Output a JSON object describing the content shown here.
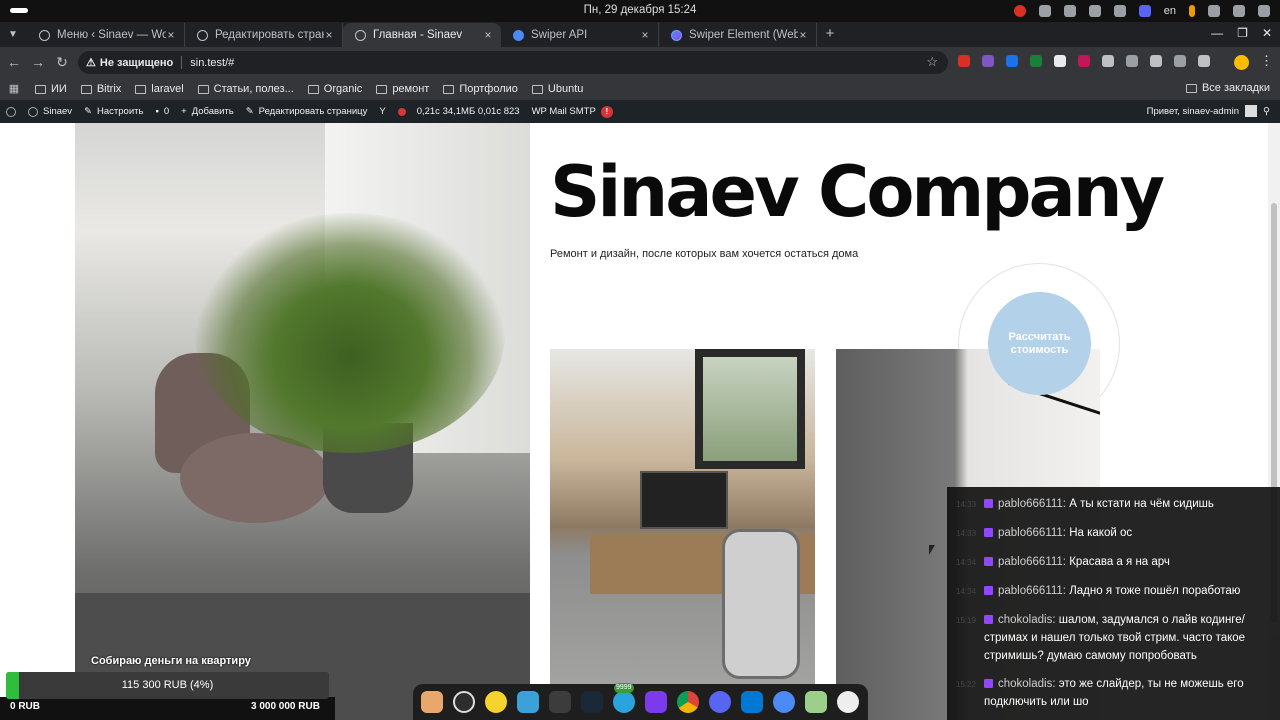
{
  "os": {
    "clock": "Пн, 29 декабря  15:24",
    "language": "en",
    "tray_icons": [
      "opera-icon",
      "telegram-icon",
      "discord-icon",
      "steam-icon",
      "equalizer-icon",
      "network-icon",
      "microphone-icon",
      "volume-icon",
      "power-icon"
    ]
  },
  "browser": {
    "tabs": [
      {
        "title": "Меню ‹ Sinaev — WordPress",
        "active": false
      },
      {
        "title": "Редактировать страницу",
        "active": false
      },
      {
        "title": "Главная - Sinaev",
        "active": true
      },
      {
        "title": "Swiper API",
        "active": false
      },
      {
        "title": "Swiper Element (WebComponent)",
        "active": false
      }
    ],
    "security_label": "Не защищено",
    "url": "sin.test/#",
    "bookmarks": [
      "ИИ",
      "Bitrix",
      "laravel",
      "Статьи, полез...",
      "Organic",
      "ремонт",
      "Портфолио",
      "Ubuntu"
    ],
    "all_bookmarks": "Все закладки"
  },
  "wp_admin": {
    "site": "Sinaev",
    "customize": "Настроить",
    "comments": "0",
    "add_new": "Добавить",
    "edit_page": "Редактировать страницу",
    "query_monitor": "0,21с  34,1МБ  0,01с  823",
    "smtp": "WP Mail SMTP",
    "smtp_badge": "!",
    "howdy": "Привет, sinaev-admin"
  },
  "site": {
    "title": "Sinaev Company",
    "subtitle": "Ремонт и дизайн, после которых вам хочется остаться дома",
    "cost_button": "Рассчитать стоимость"
  },
  "chat": [
    {
      "time": "14:33",
      "user": "pablo666111:",
      "text": "А ты кстати на чём сидишь"
    },
    {
      "time": "14:33",
      "user": "pablo666111:",
      "text": "На какой ос"
    },
    {
      "time": "14:34",
      "user": "pablo666111:",
      "text": "Красава а я на арч"
    },
    {
      "time": "14:34",
      "user": "pablo666111:",
      "text": "Ладно я тоже пошёл поработаю"
    },
    {
      "time": "15:19",
      "user": "chokoladis:",
      "text": "шалом, задумался о лайв кодинге/ стримах и нашел только твой стрим. часто такое стримишь? думаю самому попробовать"
    },
    {
      "time": "15:22",
      "user": "chokoladis:",
      "text": "это же слайдер, ты не можешь его подключить или шо"
    }
  ],
  "donation": {
    "label": "Собираю деньги на квартиру",
    "progress_text": "115 300 RUB (4%)",
    "progress_fraction": 0.04,
    "min": "0 RUB",
    "max": "3 000 000 RUB",
    "fill_color": "#2fbe3c"
  },
  "dock": {
    "apps": [
      "files-icon",
      "obs-icon",
      "rhythmbox-icon",
      "text-editor-icon",
      "terminal-icon",
      "steam-icon",
      "telegram-icon",
      "obsidian-icon",
      "chrome-icon",
      "discord-icon",
      "vscode-icon",
      "chromium-icon",
      "trash-icon",
      "settings-icon"
    ],
    "telegram_badge": "9999"
  }
}
